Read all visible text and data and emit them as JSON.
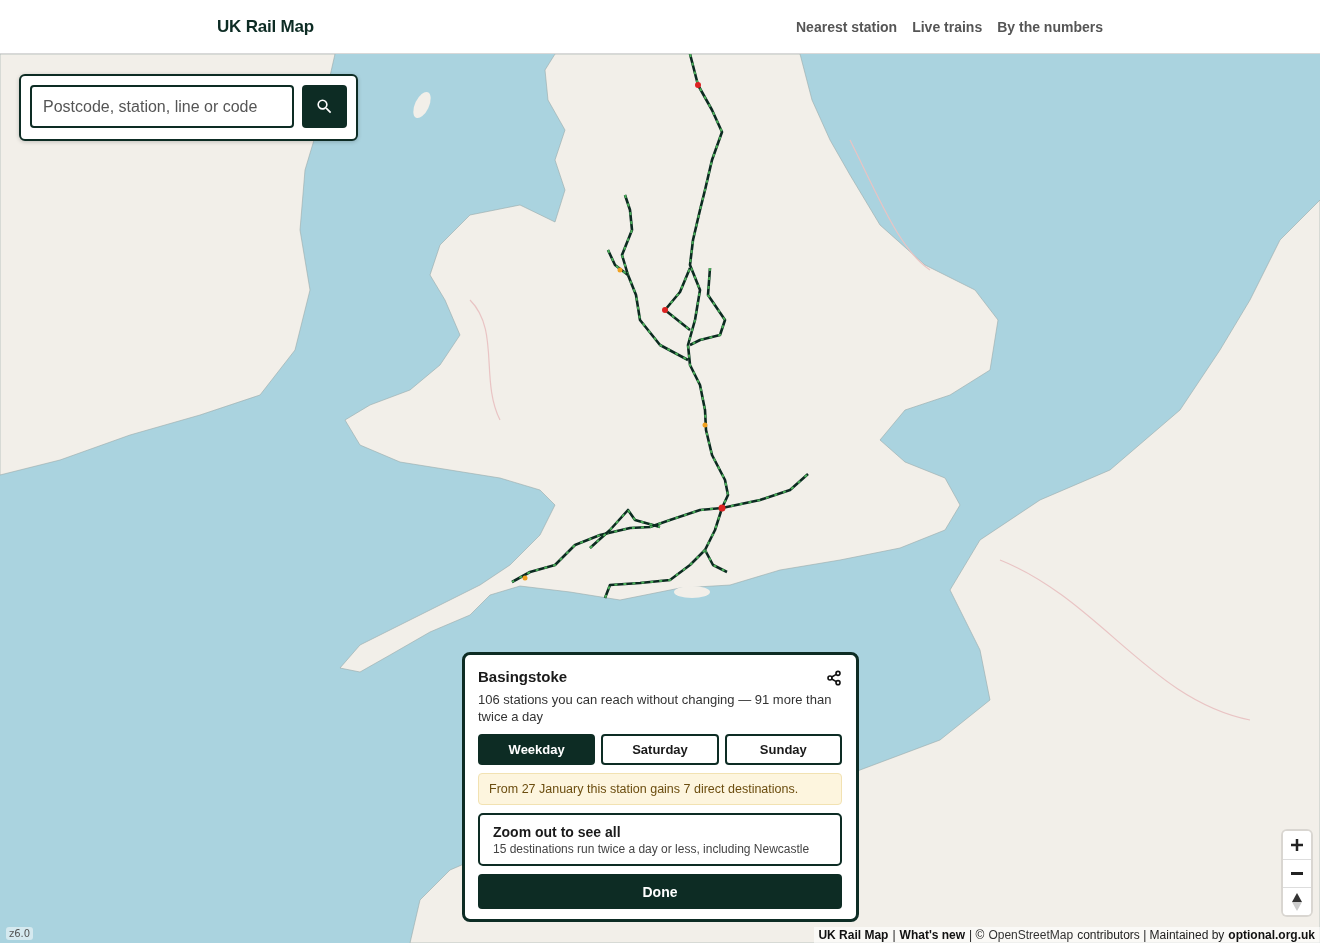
{
  "header": {
    "title": "UK Rail Map",
    "nav": [
      "Nearest station",
      "Live trains",
      "By the numbers"
    ]
  },
  "search": {
    "placeholder": "Postcode, station, line or code"
  },
  "station_panel": {
    "title": "Basingstoke",
    "summary": "106 stations you can reach without changing — 91 more than twice a day",
    "day_tabs": [
      {
        "label": "Weekday",
        "selected": true
      },
      {
        "label": "Saturday",
        "selected": false
      },
      {
        "label": "Sunday",
        "selected": false
      }
    ],
    "notice": "From 27 January this station gains 7 direct destinations.",
    "zoom_card": {
      "title": "Zoom out to see all",
      "detail": "15 destinations run twice a day or less, including Newcastle"
    },
    "done_button": "Done"
  },
  "zoom_level": "z6.0",
  "attribution": [
    {
      "kind": "strong_link",
      "text": "UK Rail Map"
    },
    {
      "kind": "text",
      "text": "|"
    },
    {
      "kind": "strong_link",
      "text": "What's new"
    },
    {
      "kind": "text",
      "text": "| ©"
    },
    {
      "kind": "link",
      "text": "OpenStreetMap"
    },
    {
      "kind": "text",
      "text": "contributors | Maintained by"
    },
    {
      "kind": "strong_link",
      "text": "optional.org.uk"
    }
  ]
}
